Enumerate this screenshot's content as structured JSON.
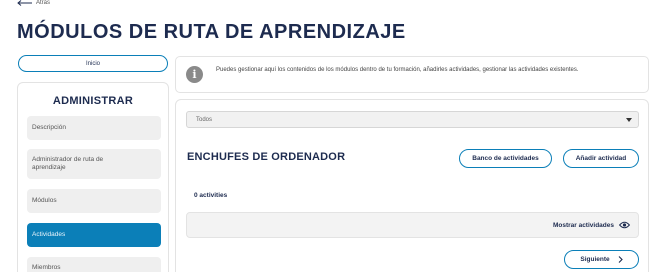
{
  "back": {
    "label": "Atrás"
  },
  "page": {
    "title": "MÓDULOS DE RUTA DE APRENDIZAJE"
  },
  "inicio": {
    "label": "Inicio"
  },
  "info": {
    "text": "Puedes gestionar aquí los contenidos de los módulos dentro de tu formación, añadirles actividades, gestionar las actividades existentes."
  },
  "sidebar": {
    "heading": "ADMINISTRAR",
    "items": [
      {
        "label": "Descripción"
      },
      {
        "label": "Administrador de ruta de aprendizaje"
      },
      {
        "label": "Módulos"
      },
      {
        "label": "Actividades",
        "active": true
      },
      {
        "label": "Miembros"
      }
    ]
  },
  "main": {
    "filter": {
      "selected": "Todos"
    },
    "section_title": "ENCHUFES DE ORDENADOR",
    "bank_button": "Banco de actividades",
    "add_button": "Añadir actividad",
    "count_label": "0 activities",
    "show_activities": "Mostrar actividades",
    "next_button": "Siguiente"
  },
  "colors": {
    "accent": "#0b7fb8",
    "heading": "#1d2b4f",
    "panel_bg": "#f3f3f3"
  }
}
